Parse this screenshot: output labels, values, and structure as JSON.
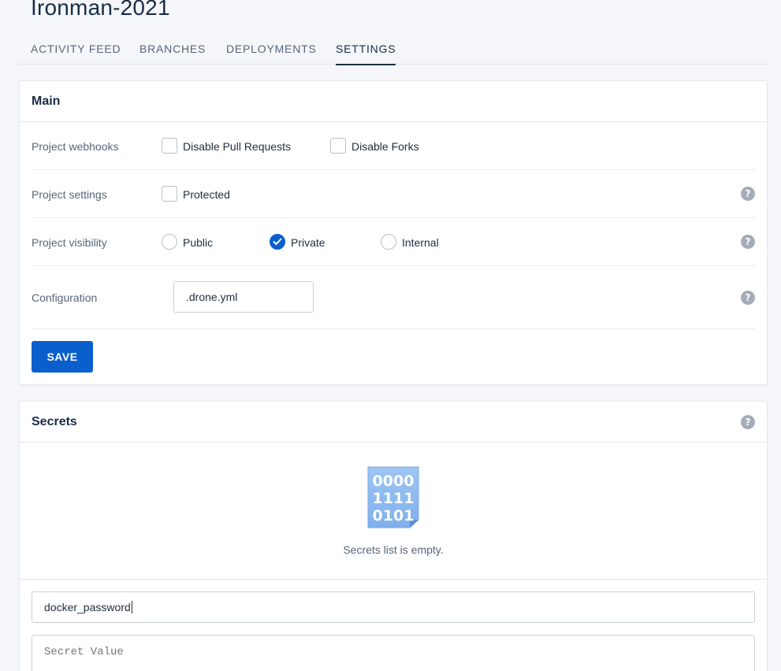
{
  "page": {
    "title": "Ironman-2021"
  },
  "tabs": [
    {
      "label": "ACTIVITY FEED",
      "active": false
    },
    {
      "label": "BRANCHES",
      "active": false
    },
    {
      "label": "DEPLOYMENTS",
      "active": false
    },
    {
      "label": "SETTINGS",
      "active": true
    }
  ],
  "main": {
    "title": "Main",
    "webhooks": {
      "label": "Project webhooks",
      "disable_pull_requests": {
        "label": "Disable Pull Requests",
        "checked": false
      },
      "disable_forks": {
        "label": "Disable Forks",
        "checked": false
      }
    },
    "settings": {
      "label": "Project settings",
      "protected": {
        "label": "Protected",
        "checked": false
      }
    },
    "visibility": {
      "label": "Project visibility",
      "options": [
        {
          "label": "Public",
          "selected": false
        },
        {
          "label": "Private",
          "selected": true
        },
        {
          "label": "Internal",
          "selected": false
        }
      ]
    },
    "configuration": {
      "label": "Configuration",
      "value": ".drone.yml"
    },
    "save_label": "SAVE"
  },
  "secrets": {
    "title": "Secrets",
    "empty_icon_lines": [
      "0000",
      "1111",
      "0101"
    ],
    "empty_text": "Secrets list is empty.",
    "name_value": "docker_password",
    "value_placeholder": "Secret Value"
  },
  "help_icon": {
    "glyph": "?"
  },
  "colors": {
    "accent": "#0a5fcd",
    "title": "#192d45",
    "muted": "#56657a",
    "icon": "#a4adb8"
  }
}
